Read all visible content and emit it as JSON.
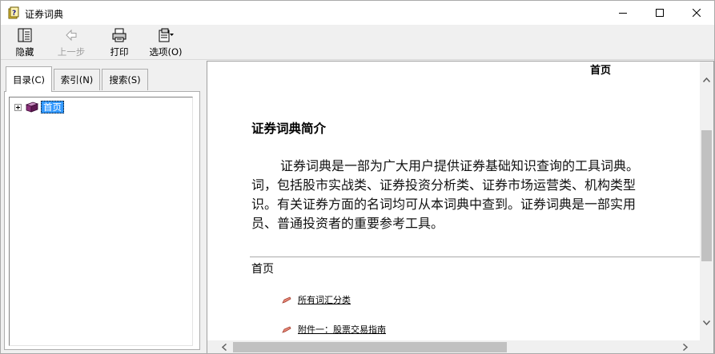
{
  "window": {
    "title": "证券词典"
  },
  "toolbar": {
    "hide_label": "隐藏",
    "back_label": "上一步",
    "print_label": "打印",
    "options_label": "选项(O)"
  },
  "left_pane": {
    "tabs": [
      {
        "label": "目录(C)"
      },
      {
        "label": "索引(N)"
      },
      {
        "label": "搜索(S)"
      }
    ],
    "tree": {
      "root_label": "首页"
    }
  },
  "document": {
    "page_title": "首页",
    "heading": "证券词典简介",
    "paragraph_lines": [
      "证券词典是一部为广大用户提供证券基础知识查询的工具词典。",
      "词，包括股市实战类、证券投资分析类、证券市场运营类、机构类型",
      "识。有关证券方面的名词均可从本词典中查到。证券词典是一部实用",
      "员、普通投资者的重要参考工具。"
    ],
    "section_label": "首页",
    "links": [
      {
        "label": "所有词汇分类"
      },
      {
        "label": "附件一：股票交易指南"
      }
    ]
  },
  "colors": {
    "selection": "#3399ff",
    "book_icon": "#8b2f7a",
    "link_icon": "#d9534f"
  }
}
